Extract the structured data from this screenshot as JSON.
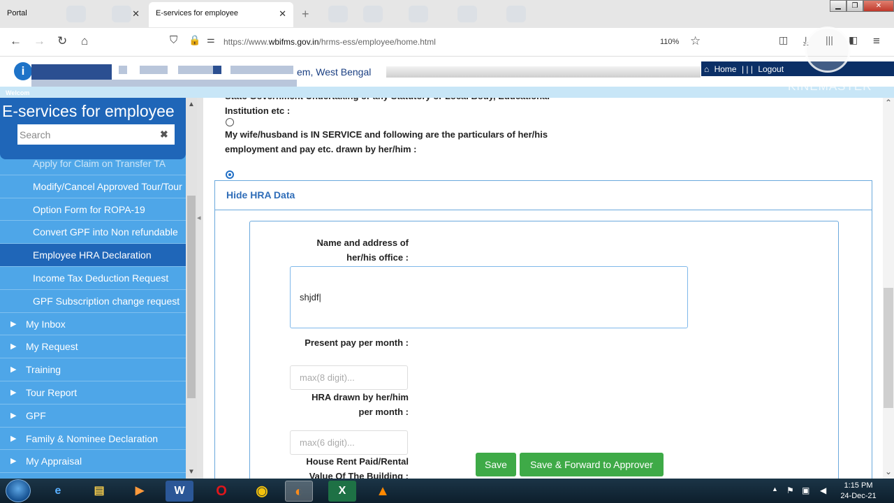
{
  "browser": {
    "tabs": [
      {
        "label": "Portal",
        "active": false
      },
      {
        "label": "E-services for employee",
        "active": true
      }
    ],
    "close_glyph": "✕",
    "newtab_glyph": "+",
    "url_prefix": "https://www.",
    "url_domain": "wbifms.gov.in",
    "url_path": "/hrms-ess/employee/home.html",
    "zoom": "110%"
  },
  "site": {
    "title_fragment": "em, West Bengal",
    "home_link": "Home",
    "separator": "| | |",
    "logout_link": "Logout",
    "welcome": "Welcom",
    "watermark": "KINEMASTER",
    "accent": "#1f66b8",
    "sidebar_bg": "#4ea6e8"
  },
  "sidebar": {
    "title": "E-services for employee",
    "search_placeholder": "Search",
    "clear_glyph": "✖",
    "items": [
      {
        "label": "Apply for Claim on Transfer TA",
        "type": "sub",
        "faded": true
      },
      {
        "label": "Modify/Cancel Approved Tour/Tour",
        "type": "sub"
      },
      {
        "label": "Option Form for ROPA-19",
        "type": "sub"
      },
      {
        "label": "Convert GPF into Non refundable",
        "type": "sub"
      },
      {
        "label": "Employee HRA Declaration",
        "type": "sub",
        "active": true
      },
      {
        "label": "Income Tax Deduction Request",
        "type": "sub"
      },
      {
        "label": "GPF Subscription change request",
        "type": "sub"
      },
      {
        "label": "My Inbox",
        "type": "top"
      },
      {
        "label": "My Request",
        "type": "top"
      },
      {
        "label": "Training",
        "type": "top"
      },
      {
        "label": "Tour Report",
        "type": "top"
      },
      {
        "label": "GPF",
        "type": "top"
      },
      {
        "label": "Family & Nominee Declaration",
        "type": "top"
      },
      {
        "label": "My Appraisal",
        "type": "top"
      }
    ]
  },
  "form": {
    "prev_text_line1": "State Government Undertaking or any Statutory or Local Body, Educational",
    "prev_text_line2": "Institution etc :",
    "option_text_line1": "My wife/husband is IN SERVICE and following are the particulars of her/his",
    "option_text_line2": "employment and pay etc. drawn by her/him :",
    "panel_title": "Hide HRA Data",
    "label_office_1": "Name and address of",
    "label_office_2": "her/his office :",
    "office_value": "shjdf",
    "label_pay": "Present pay per month :",
    "pay_placeholder": "max(8 digit)...",
    "label_hra_1": "HRA drawn by her/him",
    "label_hra_2": "per month :",
    "hra_placeholder": "max(6 digit)...",
    "label_rent_1": "House Rent Paid/Rental",
    "label_rent_2": "Value Of The Building :",
    "save_label": "Save",
    "forward_label": "Save & Forward to Approver"
  },
  "taskbar": {
    "time": "1:15 PM",
    "date": "24-Dec-21",
    "apps": [
      "start-button",
      "ie",
      "explorer",
      "media",
      "word",
      "opera",
      "chrome",
      "firefox",
      "excel",
      "vlc"
    ]
  }
}
